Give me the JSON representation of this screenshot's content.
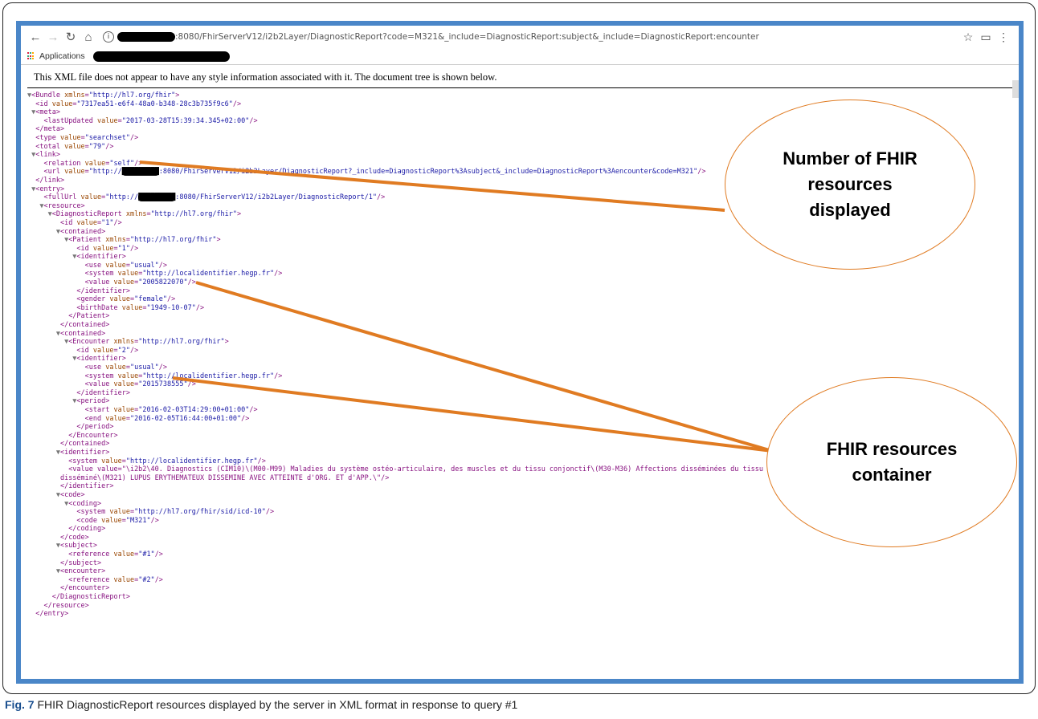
{
  "browser": {
    "url_suffix": ":8080/FhirServerV12/i2b2Layer/DiagnosticReport?code=M321&_include=DiagnosticReport:subject&_include=DiagnosticReport:encounter",
    "bookmarks_label": "Applications"
  },
  "notice": "This XML file does not appear to have any style information associated with it. The document tree is shown below.",
  "xml_lines": [
    {
      "i": 0,
      "t": "▼",
      "h": "<Bundle xmlns=\"http://hl7.org/fhir\">"
    },
    {
      "i": 1,
      "t": "",
      "h": "<id value=\"7317ea51-e6f4-48a0-b348-28c3b735f9c6\"/>"
    },
    {
      "i": 1,
      "t": "▼",
      "h": "<meta>"
    },
    {
      "i": 2,
      "t": "",
      "h": "<lastUpdated value=\"2017-03-28T15:39:34.345+02:00\"/>"
    },
    {
      "i": 1,
      "t": "",
      "h": "</meta>"
    },
    {
      "i": 1,
      "t": "",
      "h": "<type value=\"searchset\"/>"
    },
    {
      "i": 1,
      "t": "",
      "h": "<total value=\"79\"/>"
    },
    {
      "i": 1,
      "t": "▼",
      "h": "<link>"
    },
    {
      "i": 2,
      "t": "",
      "h": "<relation value=\"self\"/>"
    },
    {
      "i": 2,
      "t": "",
      "h": "<url value=\"http://█████████:8080/FhirServerV12/i2b2Layer/DiagnosticReport?_include=DiagnosticReport%3Asubject&_include=DiagnosticReport%3Aencounter&code=M321\"/>"
    },
    {
      "i": 1,
      "t": "",
      "h": "</link>"
    },
    {
      "i": 1,
      "t": "▼",
      "h": "<entry>"
    },
    {
      "i": 2,
      "t": "",
      "h": "<fullUrl value=\"http://█████████:8080/FhirServerV12/i2b2Layer/DiagnosticReport/1\"/>"
    },
    {
      "i": 2,
      "t": "▼",
      "h": "<resource>"
    },
    {
      "i": 3,
      "t": "▼",
      "h": "<DiagnosticReport xmlns=\"http://hl7.org/fhir\">"
    },
    {
      "i": 4,
      "t": "",
      "h": "<id value=\"1\"/>"
    },
    {
      "i": 4,
      "t": "▼",
      "h": "<contained>"
    },
    {
      "i": 5,
      "t": "▼",
      "h": "<Patient xmlns=\"http://hl7.org/fhir\">"
    },
    {
      "i": 6,
      "t": "",
      "h": "<id value=\"1\"/>"
    },
    {
      "i": 6,
      "t": "▼",
      "h": "<identifier>"
    },
    {
      "i": 7,
      "t": "",
      "h": "<use value=\"usual\"/>"
    },
    {
      "i": 7,
      "t": "",
      "h": "<system value=\"http://localidentifier.hegp.fr\"/>"
    },
    {
      "i": 7,
      "t": "",
      "h": "<value value=\"2005822070\"/>"
    },
    {
      "i": 6,
      "t": "",
      "h": "</identifier>"
    },
    {
      "i": 6,
      "t": "",
      "h": "<gender value=\"female\"/>"
    },
    {
      "i": 6,
      "t": "",
      "h": "<birthDate value=\"1949-10-07\"/>"
    },
    {
      "i": 5,
      "t": "",
      "h": "</Patient>"
    },
    {
      "i": 4,
      "t": "",
      "h": "</contained>"
    },
    {
      "i": 4,
      "t": "▼",
      "h": "<contained>"
    },
    {
      "i": 5,
      "t": "▼",
      "h": "<Encounter xmlns=\"http://hl7.org/fhir\">"
    },
    {
      "i": 6,
      "t": "",
      "h": "<id value=\"2\"/>"
    },
    {
      "i": 6,
      "t": "▼",
      "h": "<identifier>"
    },
    {
      "i": 7,
      "t": "",
      "h": "<use value=\"usual\"/>"
    },
    {
      "i": 7,
      "t": "",
      "h": "<system value=\"http://localidentifier.hegp.fr\"/>"
    },
    {
      "i": 7,
      "t": "",
      "h": "<value value=\"2015738555\"/>"
    },
    {
      "i": 6,
      "t": "",
      "h": "</identifier>"
    },
    {
      "i": 6,
      "t": "▼",
      "h": "<period>"
    },
    {
      "i": 7,
      "t": "",
      "h": "<start value=\"2016-02-03T14:29:00+01:00\"/>"
    },
    {
      "i": 7,
      "t": "",
      "h": "<end value=\"2016-02-05T16:44:00+01:00\"/>"
    },
    {
      "i": 6,
      "t": "",
      "h": "</period>"
    },
    {
      "i": 5,
      "t": "",
      "h": "</Encounter>"
    },
    {
      "i": 4,
      "t": "",
      "h": "</contained>"
    },
    {
      "i": 4,
      "t": "▼",
      "h": "<identifier>"
    },
    {
      "i": 5,
      "t": "",
      "h": "<system value=\"http://localidentifier.hegp.fr\"/>"
    },
    {
      "i": 5,
      "t": "",
      "h": "<value value=\"\\i2b2\\40. Diagnostics (CIM10)\\(M00-M99) Maladies du système ostéo-articulaire, des muscles et du tissu conjonctif\\(M30-M36) Affections disséminées du tissu conjonctif\\(M32) Lupus érythémateux"
    },
    {
      "i": 4,
      "t": "",
      "h": "disséminé\\(M321) LUPUS ERYTHEMATEUX DISSEMINE AVEC ATTEINTE d'ORG. ET d'APP.\\\"/>"
    },
    {
      "i": 4,
      "t": "",
      "h": "</identifier>"
    },
    {
      "i": 4,
      "t": "▼",
      "h": "<code>"
    },
    {
      "i": 5,
      "t": "▼",
      "h": "<coding>"
    },
    {
      "i": 6,
      "t": "",
      "h": "<system value=\"http://hl7.org/fhir/sid/icd-10\"/>"
    },
    {
      "i": 6,
      "t": "",
      "h": "<code value=\"M321\"/>"
    },
    {
      "i": 5,
      "t": "",
      "h": "</coding>"
    },
    {
      "i": 4,
      "t": "",
      "h": "</code>"
    },
    {
      "i": 4,
      "t": "▼",
      "h": "<subject>"
    },
    {
      "i": 5,
      "t": "",
      "h": "<reference value=\"#1\"/>"
    },
    {
      "i": 4,
      "t": "",
      "h": "</subject>"
    },
    {
      "i": 4,
      "t": "▼",
      "h": "<encounter>"
    },
    {
      "i": 5,
      "t": "",
      "h": "<reference value=\"#2\"/>"
    },
    {
      "i": 4,
      "t": "",
      "h": "</encounter>"
    },
    {
      "i": 3,
      "t": "",
      "h": "</DiagnosticReport>"
    },
    {
      "i": 2,
      "t": "",
      "h": "</resource>"
    },
    {
      "i": 1,
      "t": "",
      "h": "</entry>"
    }
  ],
  "callouts": {
    "top": "Number of FHIR resources displayed",
    "bottom": "FHIR resources container"
  },
  "colors": {
    "frame": "#4a86c8",
    "callout_border": "#e07b22",
    "arrow": "#e07b22"
  },
  "caption": {
    "label": "Fig. 7",
    "text": " FHIR DiagnosticReport resources displayed by the server in XML format in response to query #1"
  }
}
